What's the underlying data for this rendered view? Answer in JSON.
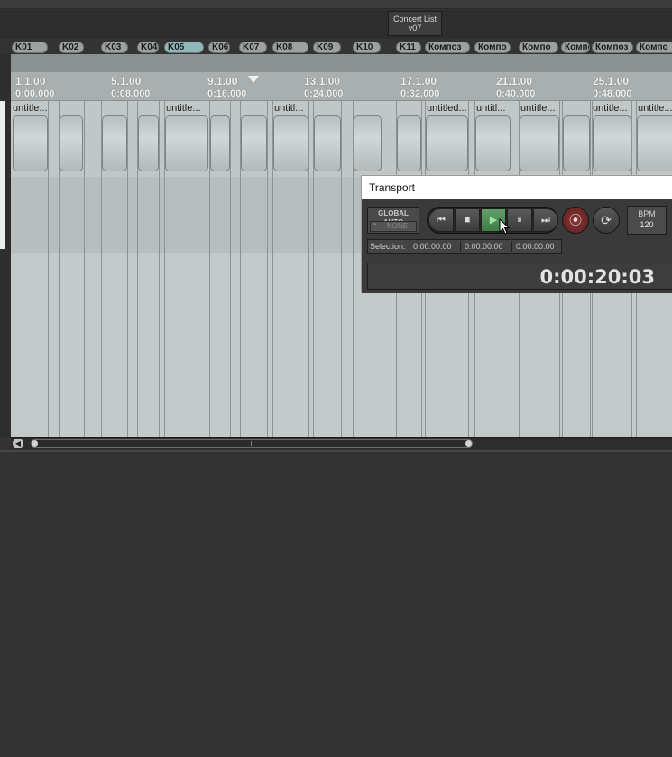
{
  "concert_marker": {
    "line1": "Concert List",
    "line2": "v07"
  },
  "regions": [
    "K01",
    "K02",
    "K03",
    "K04",
    "K05",
    "K06",
    "K07",
    "K08",
    "K09",
    "K10",
    "K11",
    "Композ",
    "Компо",
    "Компо",
    "Компо",
    "Композ",
    "Компо"
  ],
  "ruler": {
    "measures": [
      "1.1.00",
      "5.1.00",
      "9.1.00",
      "13.1.00",
      "17.1.00",
      "21.1.00",
      "25.1.00"
    ],
    "times": [
      "0:00.000",
      "0:08.000",
      "0:16.000",
      "0:24.000",
      "0:32.000",
      "0:40.000",
      "0:48.000"
    ]
  },
  "items": {
    "names": [
      "untitle...",
      "untitle...",
      "untitl...",
      "untitled...",
      "untitl...",
      "untitle...",
      "untitle...",
      "untitle..."
    ]
  },
  "transport": {
    "title": "Transport",
    "global_auto": {
      "label": "GLOBAL AUTO",
      "mode": "NONE"
    },
    "buttons": {
      "rewind": "⏮",
      "stop": "■",
      "play": "▶",
      "pause": "⏸",
      "forward": "⏭",
      "record": "⦿",
      "loop": "⟳"
    },
    "bpm": {
      "label": "BPM",
      "value": "120"
    },
    "selection": {
      "label": "Selection:",
      "start": "0:00:00:00",
      "end": "0:00:00:00",
      "length": "0:00:00:00"
    },
    "time": "0:00:20:03"
  },
  "scrollbar": {
    "left_arrow": "◀"
  }
}
